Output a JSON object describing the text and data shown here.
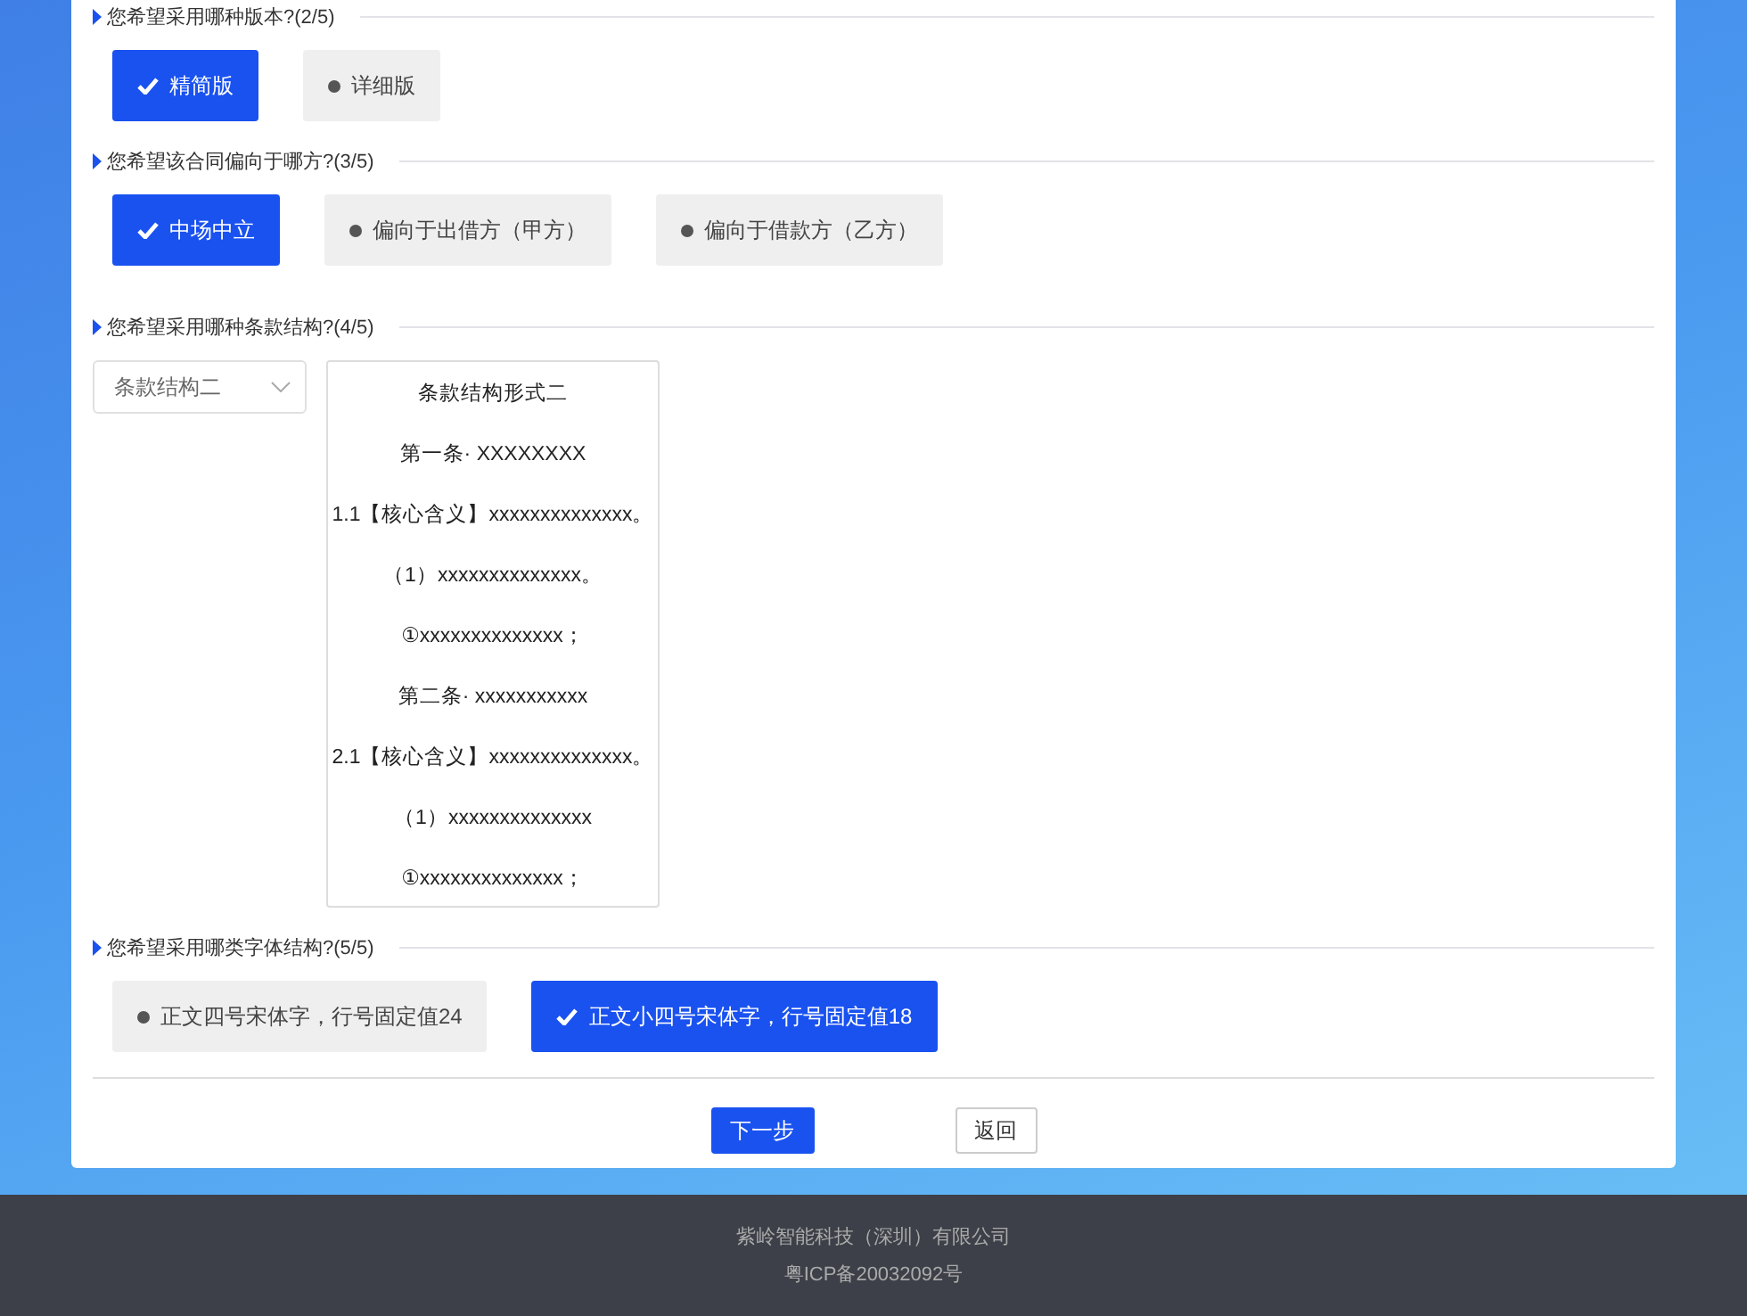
{
  "questions": [
    {
      "kind": "options",
      "title": "您希望采用哪种版本?(2/5)",
      "options": [
        {
          "label": "精简版",
          "selected": true
        },
        {
          "label": "详细版",
          "selected": false
        }
      ]
    },
    {
      "kind": "options",
      "title": "您希望该合同偏向于哪方?(3/5)",
      "options": [
        {
          "label": "中场中立",
          "selected": true
        },
        {
          "label": "偏向于出借方（甲方）",
          "selected": false
        },
        {
          "label": "偏向于借款方（乙方）",
          "selected": false
        }
      ]
    },
    {
      "kind": "clause",
      "title": "您希望采用哪种条款结构?(4/5)",
      "select": {
        "value": "条款结构二"
      },
      "preview": {
        "lines": [
          "条款结构形式二",
          "第一条· XXXXXXXX",
          "1.1【核心含义】xxxxxxxxxxxxxx。",
          "（1）xxxxxxxxxxxxxx。",
          "①xxxxxxxxxxxxxx；",
          "第二条· xxxxxxxxxxx",
          "2.1【核心含义】xxxxxxxxxxxxxx。",
          "（1）xxxxxxxxxxxxxx",
          "①xxxxxxxxxxxxxx；"
        ]
      }
    },
    {
      "kind": "options",
      "title": "您希望采用哪类字体结构?(5/5)",
      "options": [
        {
          "label": "正文四号宋体字，行号固定值24",
          "selected": false
        },
        {
          "label": "正文小四号宋体字，行号固定值18",
          "selected": true
        }
      ]
    }
  ],
  "actions": [
    {
      "label": "下一步",
      "kind": "primary"
    },
    {
      "label": "返回",
      "kind": "default"
    }
  ],
  "footer": {
    "company": "紫岭智能科技（深圳）有限公司",
    "icp": "粤ICP备20032092号"
  }
}
